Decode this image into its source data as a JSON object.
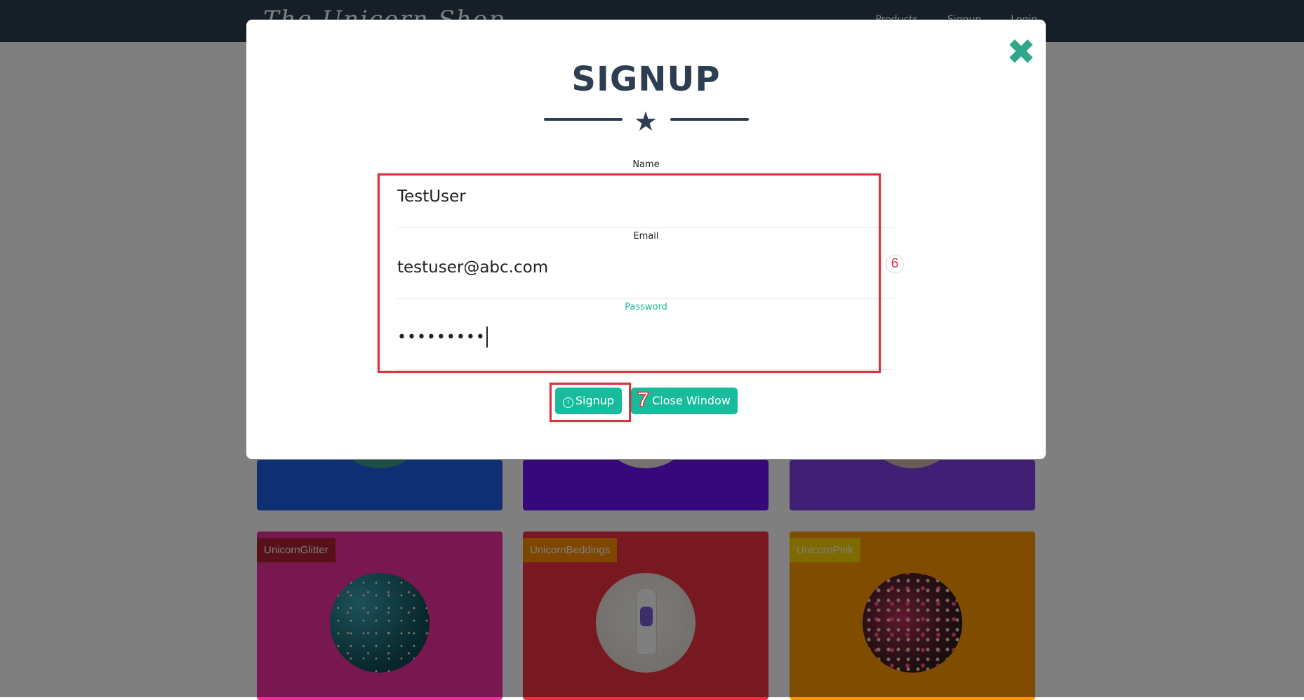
{
  "colors": {
    "accent": "#18bc9c",
    "heading": "#2c3e50",
    "annotation": "#d9333f"
  },
  "navbar": {
    "brand": "The Unicorn Shop",
    "links": [
      "Products",
      "Signup",
      "Login"
    ]
  },
  "cards": {
    "row2": [
      {
        "label": "UnicornGlitter",
        "image_icon": "sparkle-image",
        "label_bg": "#b02035",
        "bg": "#f02fa0"
      },
      {
        "label": "UnicornBeddings",
        "image_icon": "unicorn-figurine-image",
        "label_bg": "#ff8c00",
        "bg": "#f03040"
      },
      {
        "label": "UnicornPink",
        "image_icon": "crowd-image",
        "label_bg": "#ffd400",
        "bg": "#ff9800"
      }
    ]
  },
  "modal": {
    "close_icon": "close-icon",
    "title": "SIGNUP",
    "divider_icon": "star-icon",
    "fields": {
      "name": {
        "label": "Name",
        "value": "TestUser"
      },
      "email": {
        "label": "Email",
        "value": "testuser@abc.com"
      },
      "password": {
        "label": "Password",
        "value": "•••••••••"
      }
    },
    "buttons": {
      "signup": "Signup",
      "close": "Close Window"
    }
  },
  "annotations": {
    "fields_step": "6",
    "signup_step": "7"
  }
}
